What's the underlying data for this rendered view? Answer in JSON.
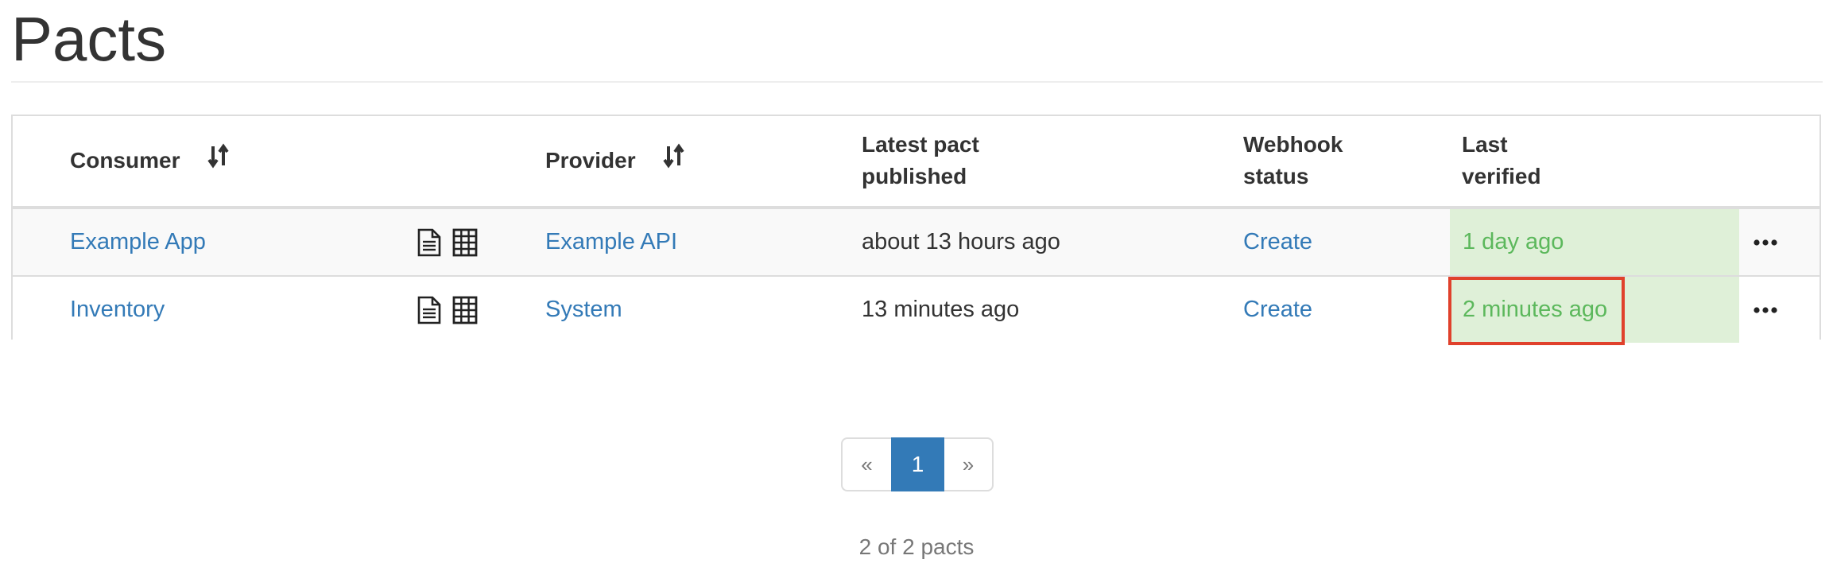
{
  "page": {
    "title": "Pacts"
  },
  "table": {
    "headers": {
      "consumer": "Consumer",
      "provider": "Provider",
      "latest_pact_line1": "Latest pact",
      "latest_pact_line2": "published",
      "webhook_line1": "Webhook",
      "webhook_line2": "status",
      "last_verified_line1": "Last",
      "last_verified_line2": "verified"
    },
    "rows": [
      {
        "consumer": "Example App",
        "provider": "Example API",
        "latest_pact_published": "about 13 hours ago",
        "webhook_status": "Create",
        "last_verified": "1 day ago"
      },
      {
        "consumer": "Inventory",
        "provider": "System",
        "latest_pact_published": "13 minutes ago",
        "webhook_status": "Create",
        "last_verified": "2 minutes ago"
      }
    ]
  },
  "pagination": {
    "prev": "«",
    "current": "1",
    "next": "»"
  },
  "footer": {
    "count_text": "2 of 2 pacts"
  },
  "colors": {
    "link": "#337ab7",
    "verified_bg": "#dff0d8",
    "verified_text": "#5cb85c",
    "highlight": "#e0412c",
    "pager_active": "#337ab7"
  },
  "icons": {
    "sort": "sort-arrows-icon",
    "pact_document": "document-icon",
    "matrix": "grid-icon",
    "menu": "ellipsis-icon"
  }
}
